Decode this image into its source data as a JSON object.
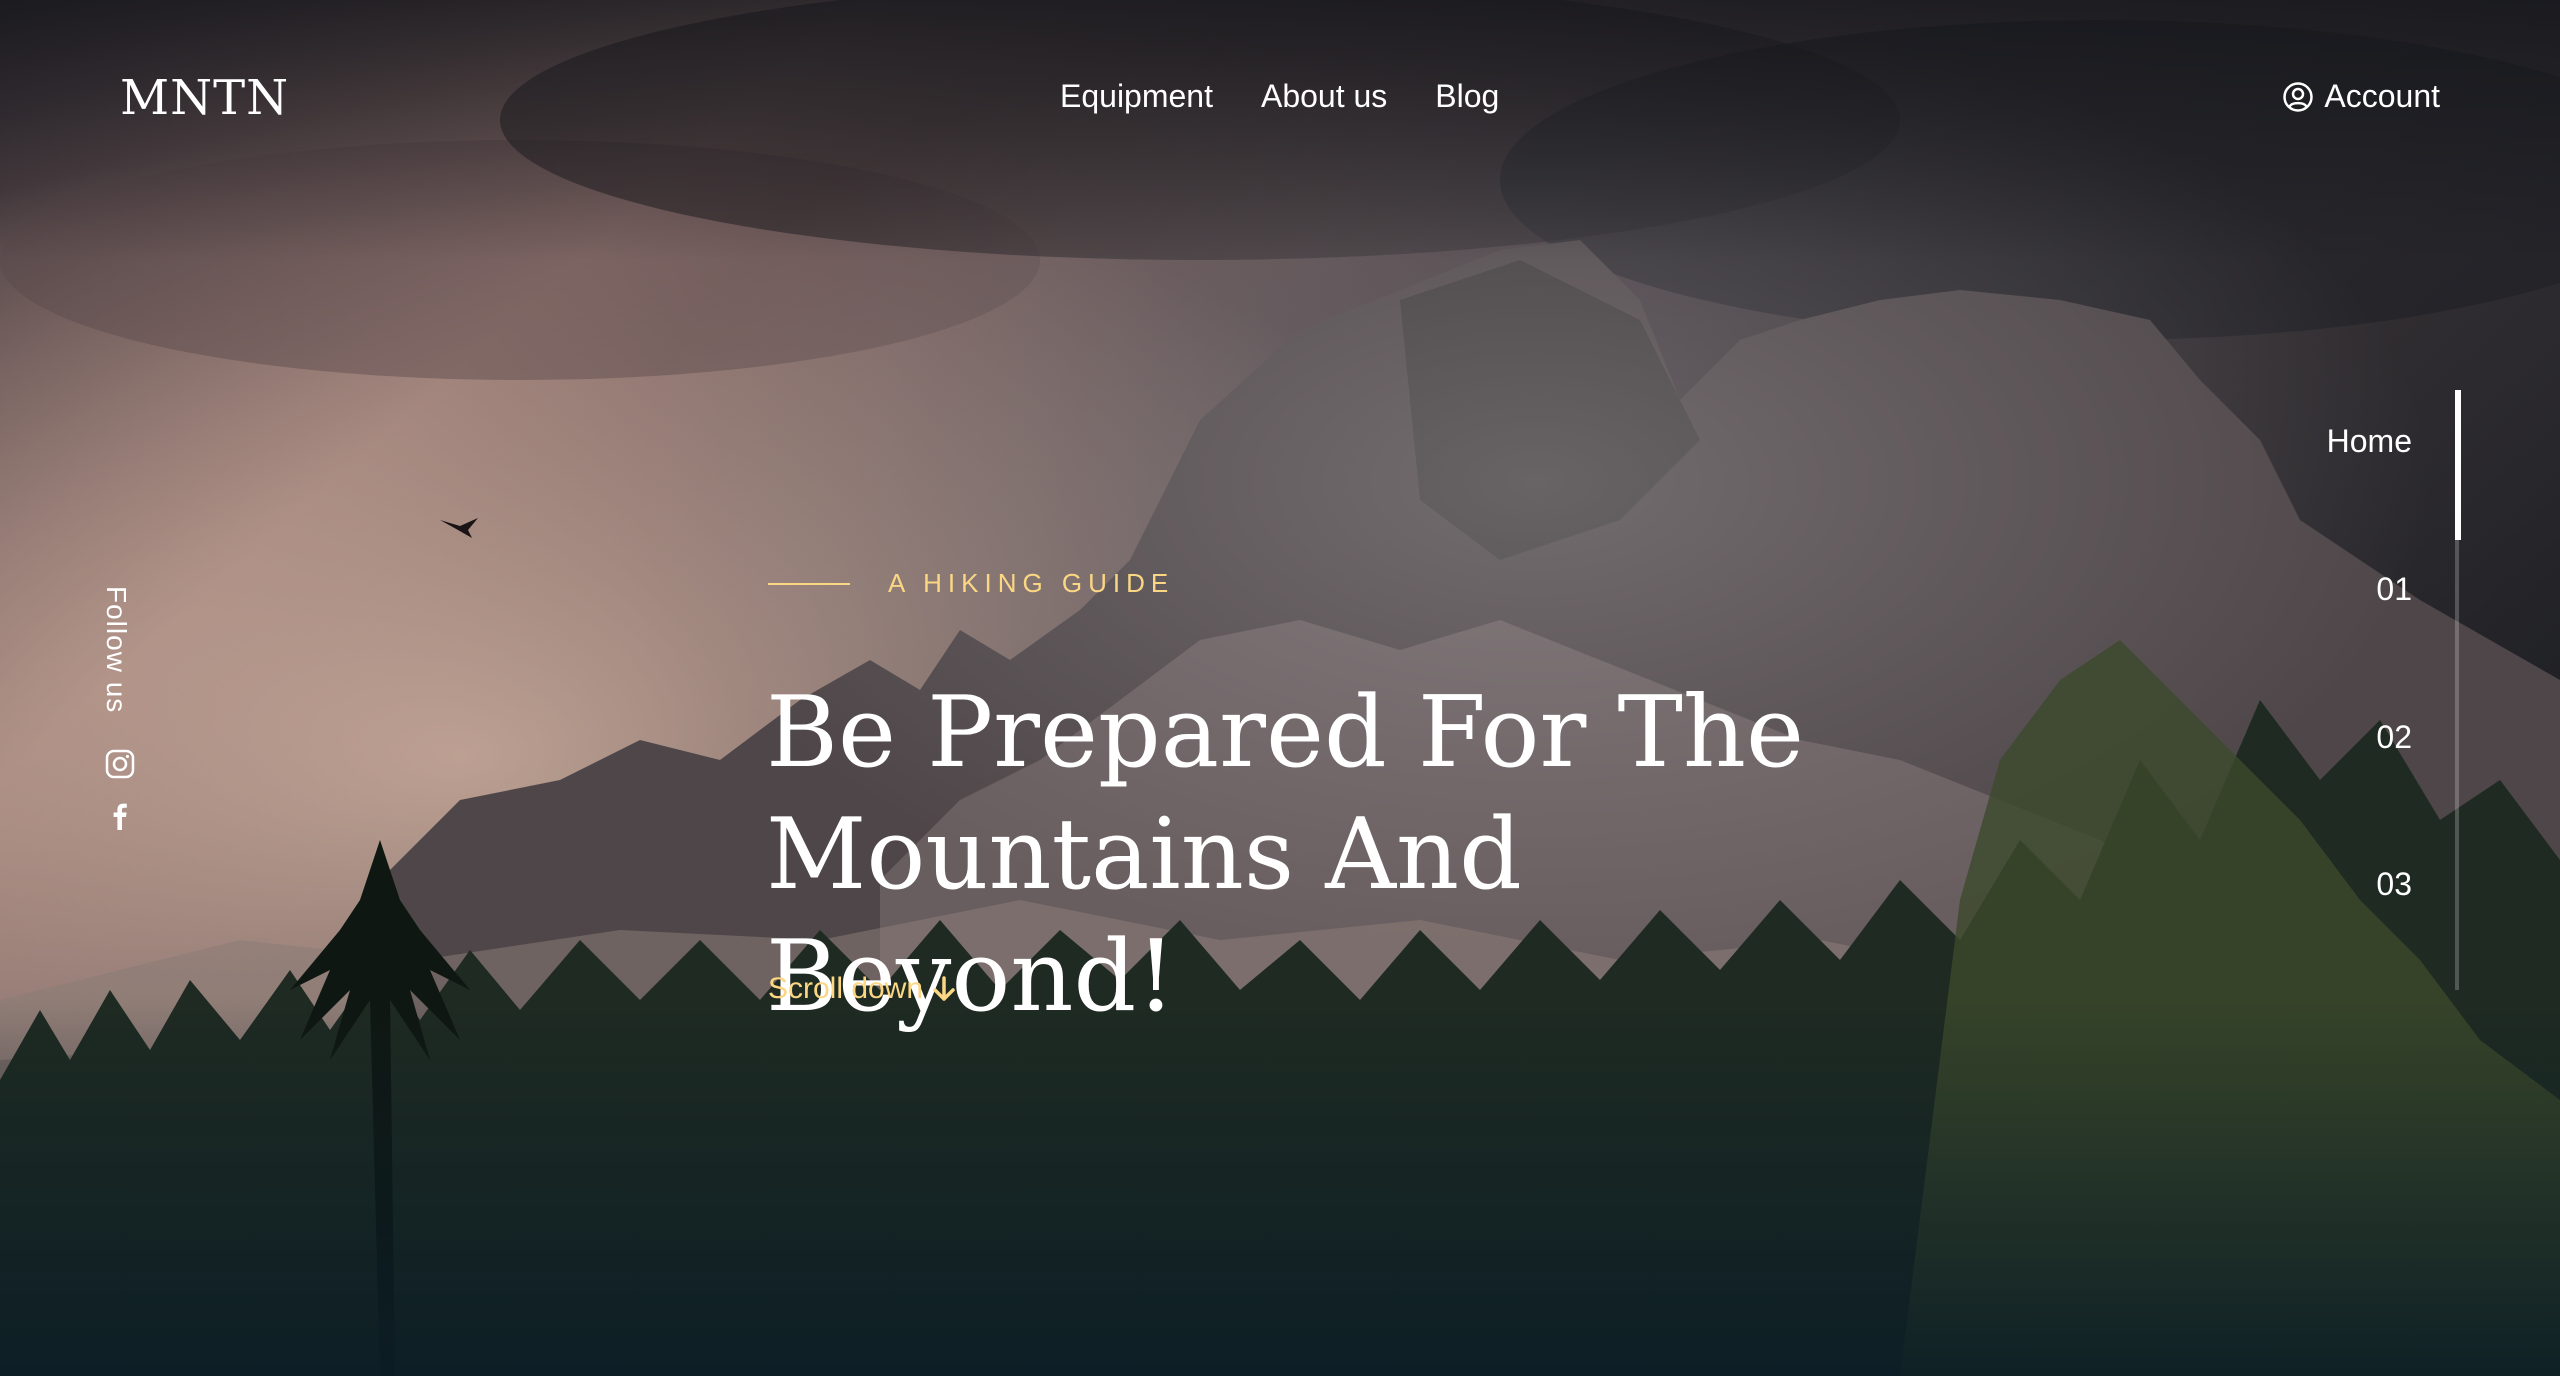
{
  "header": {
    "logo": "MNTN",
    "nav": [
      "Equipment",
      "About us",
      "Blog"
    ],
    "account_label": "Account"
  },
  "social": {
    "follow_label": "Follow us",
    "icons": [
      "instagram-icon",
      "facebook-icon"
    ]
  },
  "hero": {
    "eyebrow": "A HIKING GUIDE",
    "headline_line1": "Be Prepared For The",
    "headline_line2": "Mountains And Beyond!",
    "scroll_label": "Scroll down"
  },
  "slider": {
    "items": [
      "Home",
      "01",
      "02",
      "03"
    ],
    "active_index": 0
  },
  "colors": {
    "accent": "#fbd784",
    "text": "#ffffff",
    "background_dark": "#0b1d26"
  }
}
